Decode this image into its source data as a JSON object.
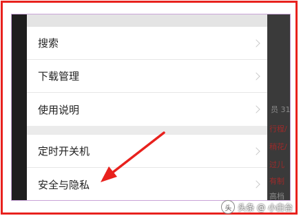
{
  "menu": {
    "group1": [
      {
        "label": "搜索"
      },
      {
        "label": "下载管理"
      },
      {
        "label": "使用说明"
      }
    ],
    "group2": [
      {
        "label": "定时开关机"
      },
      {
        "label": "安全与隐私"
      }
    ]
  },
  "background_fragments": [
    "员 31",
    "行程/",
    "稍花/",
    "过儿",
    "有制",
    "高档"
  ],
  "watermark": {
    "text": "头条 @ 小白台",
    "logo_glyph": "头"
  },
  "colors": {
    "frame": "#e8211d",
    "arrow": "#e8211d",
    "menu_bg": "#ffffff",
    "menu_gap": "#ebebeb"
  },
  "icons": [
    "chevron-right-icon",
    "annotation-arrow-icon"
  ]
}
